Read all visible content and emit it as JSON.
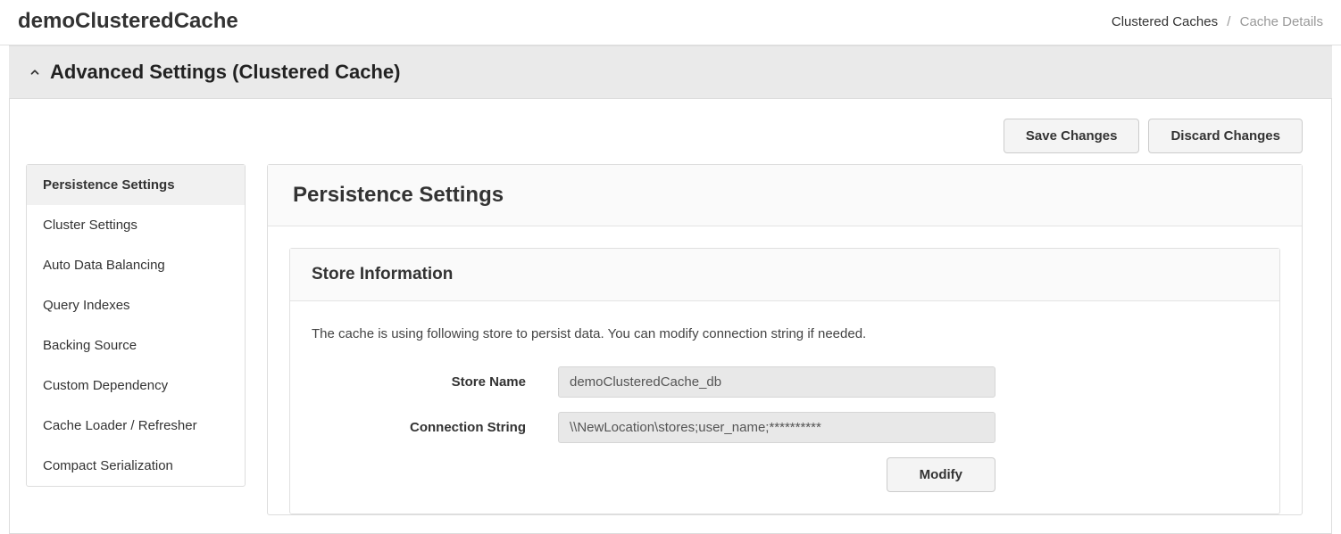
{
  "header": {
    "title": "demoClusteredCache",
    "breadcrumb": {
      "link": "Clustered Caches",
      "sep": "/",
      "current": "Cache Details"
    }
  },
  "section": {
    "title": "Advanced Settings (Clustered Cache)"
  },
  "actions": {
    "save": "Save Changes",
    "discard": "Discard Changes"
  },
  "sidebar": {
    "items": [
      "Persistence Settings",
      "Cluster Settings",
      "Auto Data Balancing",
      "Query Indexes",
      "Backing Source",
      "Custom Dependency",
      "Cache Loader / Refresher",
      "Compact Serialization"
    ]
  },
  "panel": {
    "title": "Persistence Settings"
  },
  "storeCard": {
    "title": "Store Information",
    "desc": "The cache is using following store to persist data. You can modify connection string if needed.",
    "storeNameLabel": "Store Name",
    "storeNameValue": "demoClusteredCache_db",
    "connStringLabel": "Connection String",
    "connStringValue": "\\\\NewLocation\\stores;user_name;**********",
    "modifyLabel": "Modify"
  }
}
